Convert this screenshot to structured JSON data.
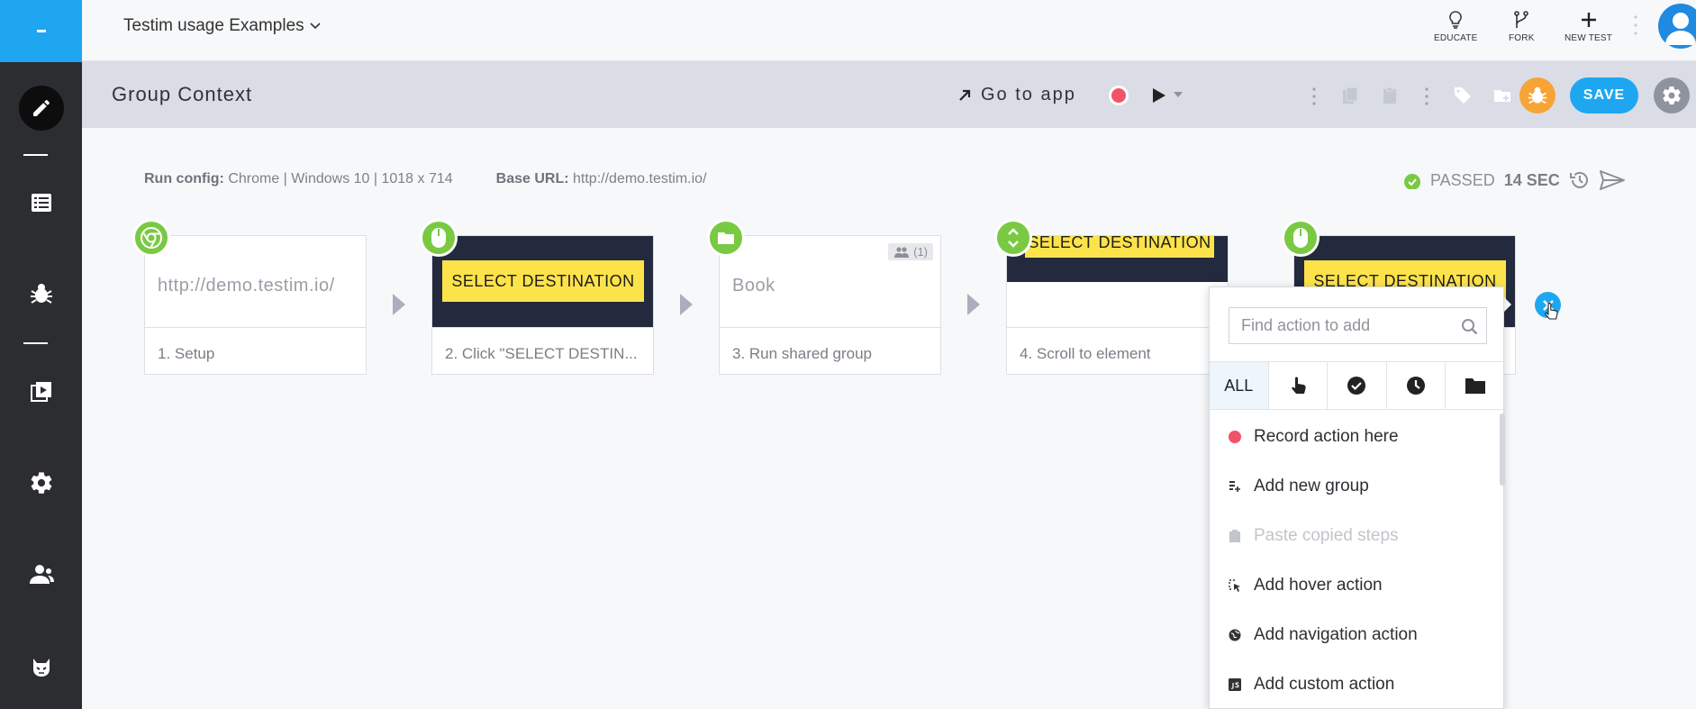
{
  "project": {
    "name": "Testim usage Examples"
  },
  "top_actions": [
    {
      "label": "EDUCATE",
      "icon": "lightbulb-icon"
    },
    {
      "label": "FORK",
      "icon": "fork-icon"
    },
    {
      "label": "NEW TEST",
      "icon": "plus-icon"
    }
  ],
  "test": {
    "title": "Group Context",
    "goto_app": "Go to app",
    "save_label": "SAVE"
  },
  "run": {
    "config_label": "Run config:",
    "config_value": "Chrome | Windows 10 | 1018 x 714",
    "base_url_label": "Base URL:",
    "base_url_value": "http://demo.testim.io/",
    "status": "PASSED",
    "duration": "14 SEC"
  },
  "steps": [
    {
      "label": "1. Setup",
      "thumb_text": "http://demo.testim.io/",
      "icon": "chrome-icon"
    },
    {
      "label": "2. Click \"SELECT DESTIN...",
      "thumb_text": "SELECT DESTINATION",
      "icon": "mouse-icon"
    },
    {
      "label": "3. Run shared group",
      "thumb_text": "Book",
      "badge": "(1)",
      "icon": "folder-icon"
    },
    {
      "label": "4. Scroll to element",
      "thumb_text": "SELECT DESTINATION",
      "icon": "scroll-icon"
    },
    {
      "label": "",
      "thumb_text": "SELECT DESTINATION",
      "icon": "mouse-icon"
    }
  ],
  "add_action": {
    "search_placeholder": "Find action to add",
    "tabs": [
      {
        "label": "ALL",
        "icon": ""
      },
      {
        "label": "",
        "icon": "pointer-icon"
      },
      {
        "label": "",
        "icon": "check-circle-icon"
      },
      {
        "label": "",
        "icon": "clock-icon"
      },
      {
        "label": "",
        "icon": "folder-icon"
      }
    ],
    "items": [
      {
        "label": "Record action here",
        "icon": "record-dot-icon",
        "disabled": false
      },
      {
        "label": "Add new group",
        "icon": "add-group-icon",
        "disabled": false
      },
      {
        "label": "Paste copied steps",
        "icon": "clipboard-icon",
        "disabled": true
      },
      {
        "label": "Add hover action",
        "icon": "hover-icon",
        "disabled": false
      },
      {
        "label": "Add navigation action",
        "icon": "navigation-icon",
        "disabled": false
      },
      {
        "label": "Add custom action",
        "icon": "js-icon",
        "disabled": false
      }
    ]
  },
  "colors": {
    "accent": "#1ea7f0",
    "step_green": "#7ac943",
    "record_red": "#f05468",
    "bug_orange": "#f7a436"
  }
}
